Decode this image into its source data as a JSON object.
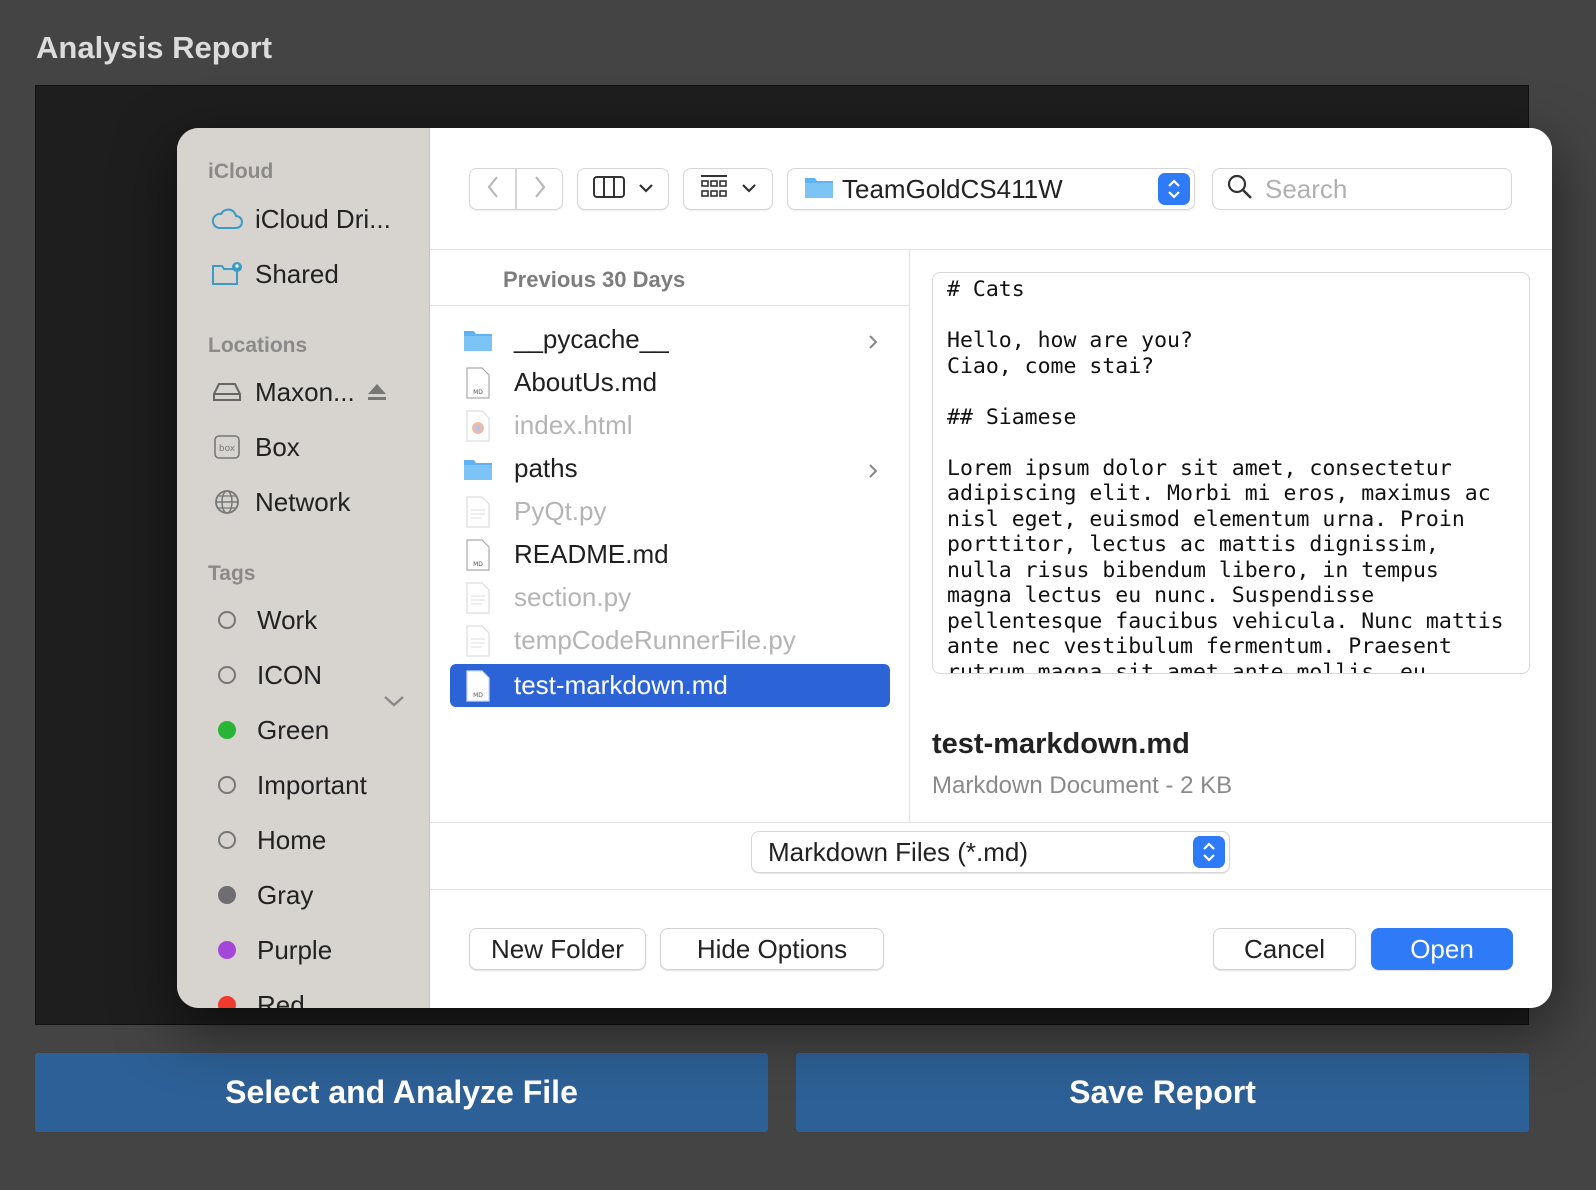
{
  "app": {
    "title": "Analysis Report",
    "analyze_button": "Select and Analyze File",
    "save_button": "Save Report"
  },
  "dialog": {
    "sidebar": {
      "icloud_header": "iCloud",
      "icloud_items": [
        {
          "label": "iCloud Dri...",
          "icon": "cloud-icon"
        },
        {
          "label": "Shared",
          "icon": "shared-folder-icon"
        }
      ],
      "locations_header": "Locations",
      "location_items": [
        {
          "label": "Maxon...",
          "icon": "drive-icon"
        },
        {
          "label": "Box",
          "icon": "box-icon"
        },
        {
          "label": "Network",
          "icon": "globe-icon"
        }
      ],
      "tags_header": "Tags",
      "tags": [
        {
          "label": "Work",
          "color": ""
        },
        {
          "label": "ICON",
          "color": ""
        },
        {
          "label": "Green",
          "color": "#28b436"
        },
        {
          "label": "Important",
          "color": ""
        },
        {
          "label": "Home",
          "color": ""
        },
        {
          "label": "Gray",
          "color": "#6e6e72"
        },
        {
          "label": "Purple",
          "color": "#a446d8"
        },
        {
          "label": "Red",
          "color": "#f03a2e"
        }
      ]
    },
    "toolbar": {
      "current_folder": "TeamGoldCS411W",
      "search_placeholder": "Search"
    },
    "file_list": {
      "section_header": "Previous 30 Days",
      "items": [
        {
          "name": "__pycache__",
          "type": "folder",
          "enabled": true
        },
        {
          "name": "AboutUs.md",
          "type": "md",
          "enabled": true
        },
        {
          "name": "index.html",
          "type": "html",
          "enabled": false
        },
        {
          "name": "paths",
          "type": "folder",
          "enabled": true
        },
        {
          "name": "PyQt.py",
          "type": "py",
          "enabled": false
        },
        {
          "name": "README.md",
          "type": "md",
          "enabled": true
        },
        {
          "name": "section.py",
          "type": "py",
          "enabled": false
        },
        {
          "name": "tempCodeRunnerFile.py",
          "type": "py",
          "enabled": false
        },
        {
          "name": "test-markdown.md",
          "type": "md",
          "enabled": true,
          "selected": true
        }
      ]
    },
    "preview": {
      "content": "# Cats\n\nHello, how are you?\nCiao, come stai?\n\n## Siamese\n\nLorem ipsum dolor sit amet, consectetur\nadipiscing elit. Morbi mi eros, maximus ac\nnisl eget, euismod elementum urna. Proin\nporttitor, lectus ac mattis dignissim,\nnulla risus bibendum libero, in tempus\nmagna lectus eu nunc. Suspendisse\npellentesque faucibus vehicula. Nunc mattis\nante nec vestibulum fermentum. Praesent\nrutrum magna sit amet ante mollis, eu",
      "file_name": "test-markdown.md",
      "file_kind": "Markdown Document - 2 KB"
    },
    "filter": "Markdown Files (*.md)",
    "buttons": {
      "new_folder": "New Folder",
      "hide_options": "Hide Options",
      "cancel": "Cancel",
      "open": "Open"
    },
    "colors": {
      "accent": "#2f7af6",
      "selection": "#2c64d8",
      "app_button": "#2d6096"
    }
  }
}
